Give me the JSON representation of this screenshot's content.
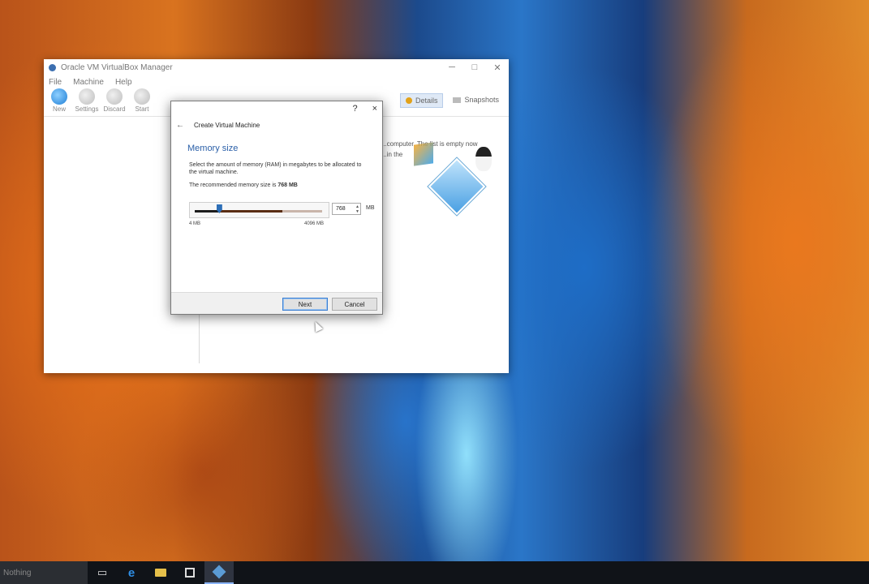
{
  "manager": {
    "title": "Oracle VM VirtualBox Manager",
    "menu": [
      "File",
      "Machine",
      "Help"
    ],
    "toolbar": [
      "New",
      "Settings",
      "Discard",
      "Start"
    ],
    "details_label": "Details",
    "snapshots_label": "Snapshots",
    "welcome_line1": "...computer. The list is empty now",
    "welcome_line2": "...in the"
  },
  "dialog": {
    "help": "?",
    "close": "×",
    "wizard_title": "Create Virtual Machine",
    "heading": "Memory size",
    "description": "Select the amount of memory (RAM) in megabytes to be allocated to the virtual machine.",
    "recommended_prefix": "The recommended memory size is",
    "recommended_value": "768 MB",
    "memory_value": "768",
    "unit": "MB",
    "scale_min": "4 MB",
    "scale_max": "4096 MB",
    "next_label": "Next",
    "cancel_label": "Cancel",
    "slider_fraction": 0.19
  },
  "taskbar": {
    "search_text": "Nothing"
  },
  "colors": {
    "accent_blue": "#2a5fa8",
    "taskbar": "#101318"
  }
}
